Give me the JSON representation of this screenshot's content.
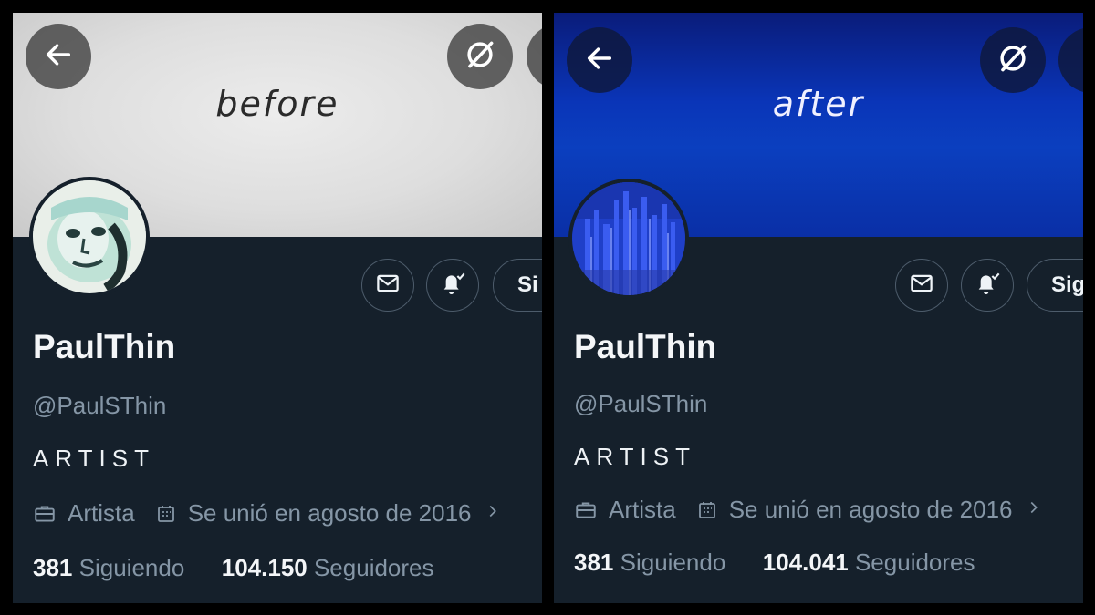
{
  "before": {
    "banner_text": "before",
    "name": "PaulThin",
    "handle": "@PaulSThin",
    "bio": "ARTIST",
    "category": "Artista",
    "joined": "Se unió en agosto de 2016",
    "following_count": "381",
    "following_label": "Siguiendo",
    "followers_count": "104.150",
    "followers_label": "Seguidores",
    "follow_button": "Si"
  },
  "after": {
    "banner_text": "after",
    "name": "PaulThin",
    "handle": "@PaulSThin",
    "bio": "ARTIST",
    "category": "Artista",
    "joined": "Se unió en agosto de 2016",
    "following_count": "381",
    "following_label": "Siguiendo",
    "followers_count": "104.041",
    "followers_label": "Seguidores",
    "follow_button": "Sig"
  },
  "icons": {
    "back": "arrow-left-icon",
    "grok": "grok-icon",
    "message": "envelope-icon",
    "notifications": "bell-check-icon",
    "category": "briefcase-icon",
    "joined": "calendar-icon",
    "more": "chevron-right-icon"
  },
  "colors": {
    "background": "#15202b",
    "before_banner": "#dedede",
    "after_banner": "#0b3fbf",
    "muted_text": "#8596a6"
  }
}
